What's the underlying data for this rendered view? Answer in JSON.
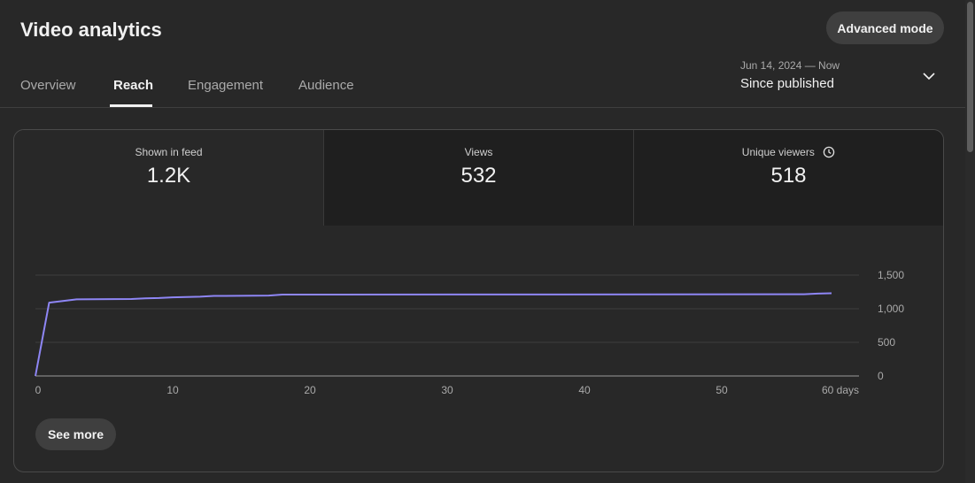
{
  "header": {
    "title": "Video analytics",
    "advanced_mode_label": "Advanced mode"
  },
  "tabs": [
    {
      "label": "Overview",
      "active": false
    },
    {
      "label": "Reach",
      "active": true
    },
    {
      "label": "Engagement",
      "active": false
    },
    {
      "label": "Audience",
      "active": false
    }
  ],
  "date_picker": {
    "range": "Jun 14, 2024 — Now",
    "label": "Since published",
    "icon": "chevron-down-icon"
  },
  "metrics": [
    {
      "label": "Shown in feed",
      "value": "1.2K",
      "selected": true
    },
    {
      "label": "Views",
      "value": "532",
      "selected": false
    },
    {
      "label": "Unique viewers",
      "value": "518",
      "selected": false,
      "icon": "clock-icon"
    }
  ],
  "see_more_label": "See more",
  "colors": {
    "background": "#282828",
    "line": "#8e86f5",
    "grid": "#3e3e3e"
  },
  "chart_data": {
    "type": "line",
    "x_ticks": [
      "0",
      "10",
      "20",
      "30",
      "40",
      "50",
      "60 days"
    ],
    "y_ticks": [
      "0",
      "500",
      "1,000",
      "1,500"
    ],
    "xlim": [
      0,
      60
    ],
    "ylim": [
      0,
      1500
    ],
    "grid": true,
    "y_axis_position": "right",
    "series": [
      {
        "x": [
          0,
          1,
          3,
          7,
          8,
          9,
          10,
          11,
          12,
          13,
          17,
          18,
          56,
          57,
          58
        ],
        "y": [
          0,
          1090,
          1140,
          1145,
          1155,
          1160,
          1170,
          1175,
          1180,
          1190,
          1195,
          1210,
          1215,
          1225,
          1230
        ]
      }
    ]
  }
}
